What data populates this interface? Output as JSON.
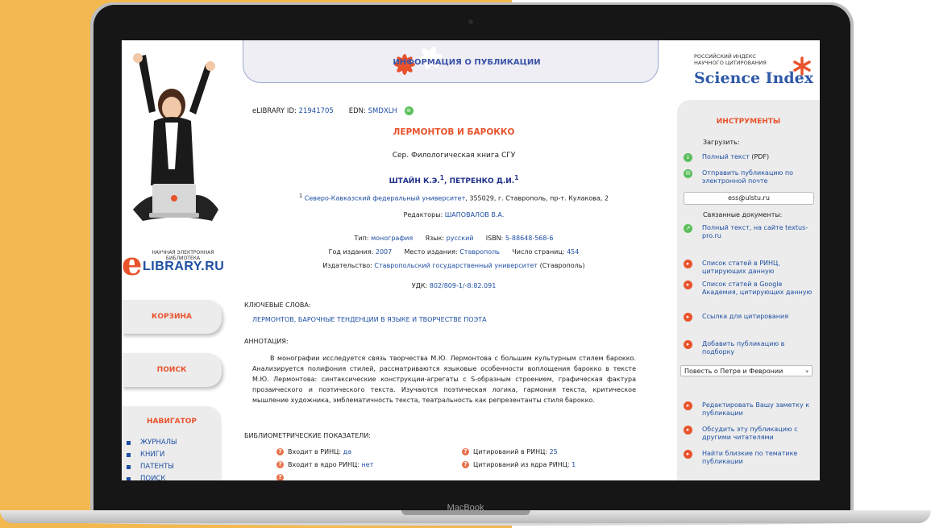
{
  "device": {
    "brand": "MacBook"
  },
  "header": {
    "title": "ИНФОРМАЦИЯ О ПУБЛИКАЦИИ"
  },
  "science_index": {
    "line1": "РОССИЙСКИЙ ИНДЕКС",
    "line2": "НАУЧНОГО ЦИТИРОВАНИЯ",
    "name": "Science Index"
  },
  "logo": {
    "line1": "НАУЧНАЯ ЭЛЕКТРОННАЯ",
    "line2": "БИБЛИОТЕКА",
    "e": "e",
    "name": "LIBRARY.RU"
  },
  "sidebar": {
    "cart": "КОРЗИНА",
    "search": "ПОИСК",
    "navigator": "НАВИГАТОР",
    "items": [
      {
        "label": "ЖУРНАЛЫ"
      },
      {
        "label": "КНИГИ"
      },
      {
        "label": "ПАТЕНТЫ"
      },
      {
        "label": "ПОИСК"
      }
    ]
  },
  "publication": {
    "elibrary_id_label": "eLIBRARY ID:",
    "elibrary_id": "21941705",
    "edn_label": "EDN:",
    "edn": "SMDXLH",
    "title": "ЛЕРМОНТОВ И БАРОККО",
    "series": "Сер. Филологическая книга СГУ",
    "authors": "ШТАЙН К.Э.",
    "authors_sup": "1",
    "authors_sep": ", ",
    "authors2": "ПЕТРЕНКО Д.И.",
    "authors2_sup": "1",
    "affil_sup": "1",
    "affil_link": "Северо-Кавказский федеральный университет",
    "affil_rest": ", 355029, г. Ставрополь, пр-т. Кулакова, 2",
    "editors_label": "Редакторы:",
    "editors": "ШАПОВАЛОВ В.А.",
    "type_label": "Тип:",
    "type": "монография",
    "lang_label": "Язык:",
    "lang": "русский",
    "isbn_label": "ISBN:",
    "isbn": "5-88648-568-6",
    "year_label": "Год издания:",
    "year": "2007",
    "place_label": "Место издания:",
    "place": "Ставрополь",
    "pages_label": "Число страниц:",
    "pages": "454",
    "publisher_label": "Издательство:",
    "publisher": "Ставропольский государственный университет",
    "publisher_suffix": " (Ставрополь)",
    "udk_label": "УДК:",
    "udk": "802/809-1/-8:82.091",
    "keywords_head": "КЛЮЧЕВЫЕ СЛОВА:",
    "keywords": "ЛЕРМОНТОВ, БАРОЧНЫЕ ТЕНДЕНЦИИ В ЯЗЫКЕ И ТВОРЧЕСТВЕ ПОЭТА",
    "abstract_head": "АННОТАЦИЯ:",
    "abstract": "В монографии исследуется связь творчества М.Ю. Лермонтова с большим культурным стилем барокко. Анализируется полифония стилей, рассматриваются языковые особенности воплощения барокко в тексте М.Ю. Лермонтова: синтаксические конструкции-агрегаты с S-образным строением, графическая фактура прозаического и поэтического текста. Изучаются поэтическая логика, гармония текста, критическое мышление художника, эмблематичность текста, театральность как репрезентанты стиля барокко.",
    "bib_head": "БИБЛИОМЕТРИЧЕСКИЕ ПОКАЗАТЕЛИ:",
    "bib": [
      {
        "label": "Входит в РИНЦ:",
        "value": "да"
      },
      {
        "label": "Входит в ядро РИНЦ:",
        "value": "нет"
      },
      {
        "label": "Цитирований в РИНЦ:",
        "value": "25"
      },
      {
        "label": "Цитирований из ядра РИНЦ:",
        "value": "1"
      }
    ]
  },
  "tools": {
    "title": "ИНСТРУМЕНТЫ",
    "download_label": "Загрузить:",
    "full_text": "Полный текст",
    "full_text_suffix": " (PDF)",
    "send_email": "Отправить публикацию по электронной почте",
    "email_value": "ess@ulstu.ru",
    "related_label": "Связанные документы:",
    "full_text_site": "Полный текст, на сайте textus-pro.ru",
    "rinc_list": "Список статей в РИНЦ, цитирующих данную",
    "google_list": "Список статей в Google Академия, цитирующих данную",
    "cite_link": "Ссылка для цитирования",
    "add_to": "Добавить публикацию в подборку",
    "select_value": "Повесть о Петре и Февронии",
    "edit_note": "Редактировать Вашу заметку к публикации",
    "discuss": "Обсудить эту публикацию с другими читателями",
    "find_similar": "Найти близкие по тематике публикации"
  },
  "colors": {
    "accent": "#e8532c",
    "link": "#1e4fa3",
    "panel": "#ececec",
    "background": "#f3b950"
  }
}
